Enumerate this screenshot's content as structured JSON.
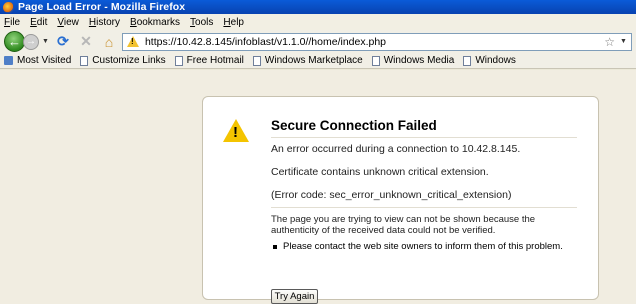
{
  "window": {
    "title": "Page Load Error - Mozilla Firefox"
  },
  "menu": [
    "File",
    "Edit",
    "View",
    "History",
    "Bookmarks",
    "Tools",
    "Help"
  ],
  "navigation": {
    "url": "https://10.42.8.145/infoblast/v1.1.0//home/index.php"
  },
  "bookmarks": [
    "Most Visited",
    "Customize Links",
    "Free Hotmail",
    "Windows Marketplace",
    "Windows Media",
    "Windows"
  ],
  "error": {
    "title": "Secure Connection Failed",
    "line1": "An error occurred during a connection to 10.42.8.145.",
    "line2": "Certificate contains unknown critical extension.",
    "line3": "(Error code: sec_error_unknown_critical_extension)",
    "detail": "The page you are trying to view can not be shown because the authenticity of the received data could not be verified.",
    "bullet": "Please contact the web site owners to inform them of this problem.",
    "button": "Try Again"
  }
}
